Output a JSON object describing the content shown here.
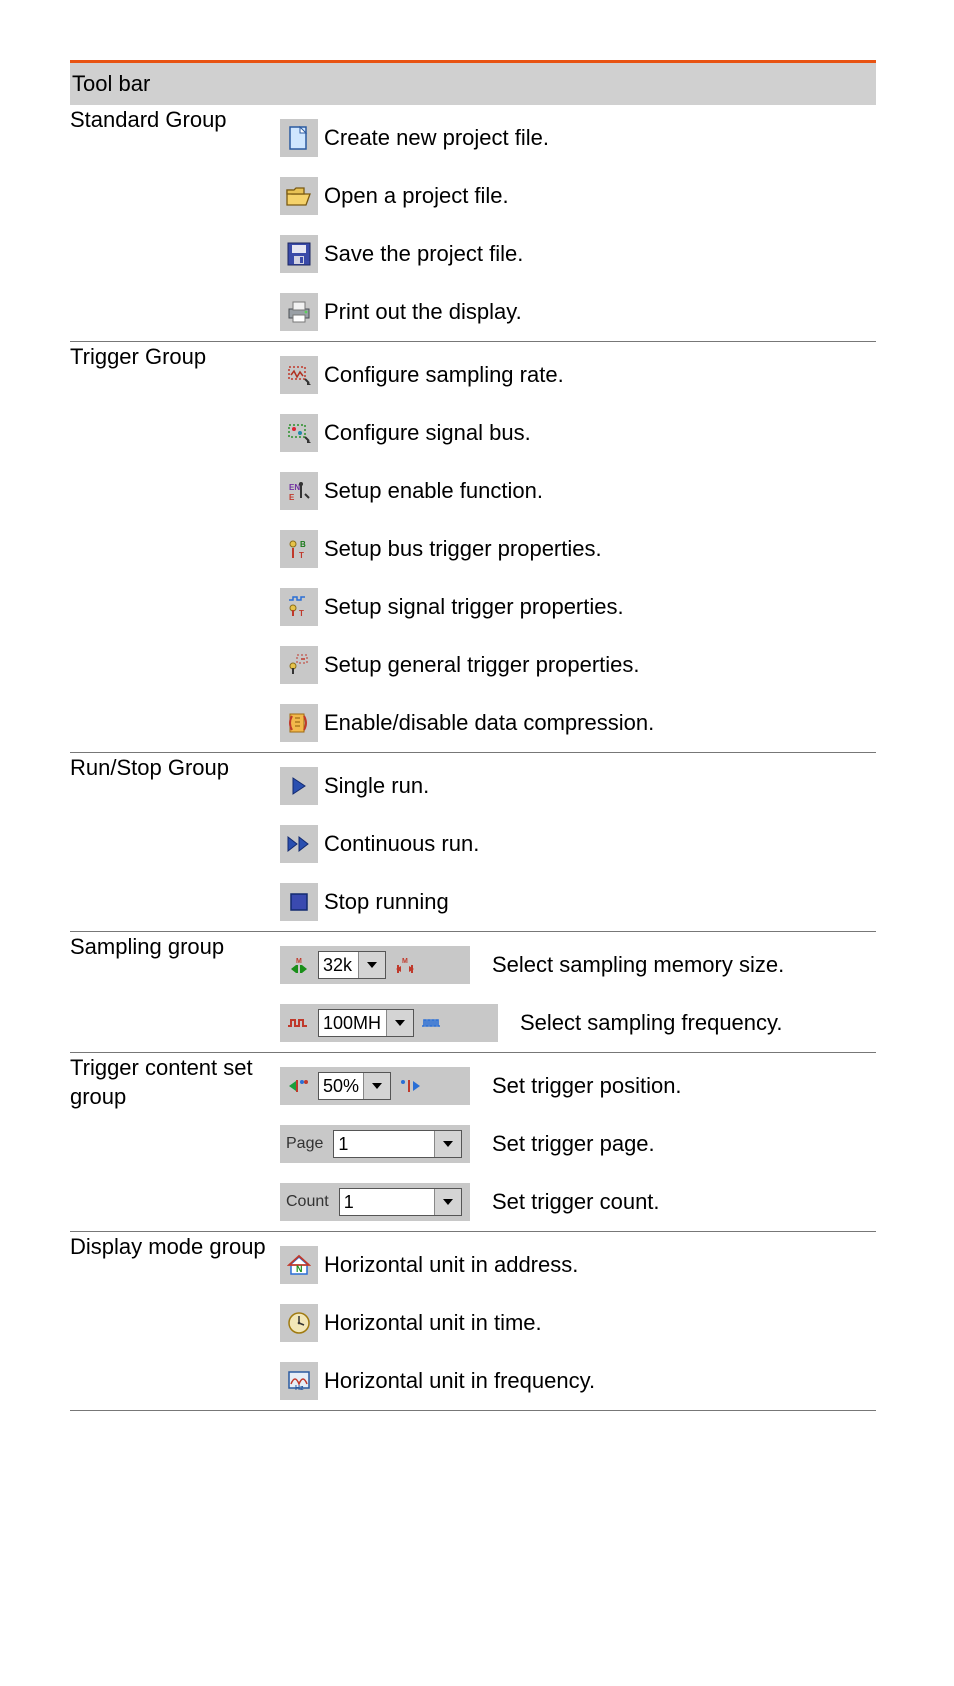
{
  "header": {
    "title": "Tool bar"
  },
  "groups": {
    "standard": {
      "label": "Standard Group",
      "items": [
        {
          "desc": "Create new project file."
        },
        {
          "desc": "Open a project file."
        },
        {
          "desc": "Save the project file."
        },
        {
          "desc": "Print out the display."
        }
      ]
    },
    "trigger": {
      "label": "Trigger Group",
      "items": [
        {
          "desc": "Configure sampling rate."
        },
        {
          "desc": "Configure signal bus."
        },
        {
          "desc": "Setup enable function."
        },
        {
          "desc": "Setup bus trigger properties."
        },
        {
          "desc": "Setup signal trigger properties."
        },
        {
          "desc": "Setup general trigger properties."
        },
        {
          "desc": "Enable/disable data compression."
        }
      ]
    },
    "runstop": {
      "label": "Run/Stop Group",
      "items": [
        {
          "desc": "Single run."
        },
        {
          "desc": "Continuous run."
        },
        {
          "desc": "Stop running"
        }
      ]
    },
    "sampling": {
      "label": "Sampling group",
      "items": [
        {
          "value": "32k",
          "desc": "Select sampling memory size."
        },
        {
          "value": "100MH",
          "desc": "Select sampling frequency."
        }
      ]
    },
    "triggercontent": {
      "label": "Trigger content set group",
      "items": [
        {
          "value": "50%",
          "desc": "Set trigger position."
        },
        {
          "ctl_label": "Page",
          "value": "1",
          "desc": "Set trigger page."
        },
        {
          "ctl_label": "Count",
          "value": "1",
          "desc": "Set trigger count."
        }
      ]
    },
    "display": {
      "label": "Display mode group",
      "items": [
        {
          "desc": "Horizontal unit in address."
        },
        {
          "desc": "Horizontal unit in time."
        },
        {
          "desc": "Horizontal unit in frequency."
        }
      ]
    }
  }
}
